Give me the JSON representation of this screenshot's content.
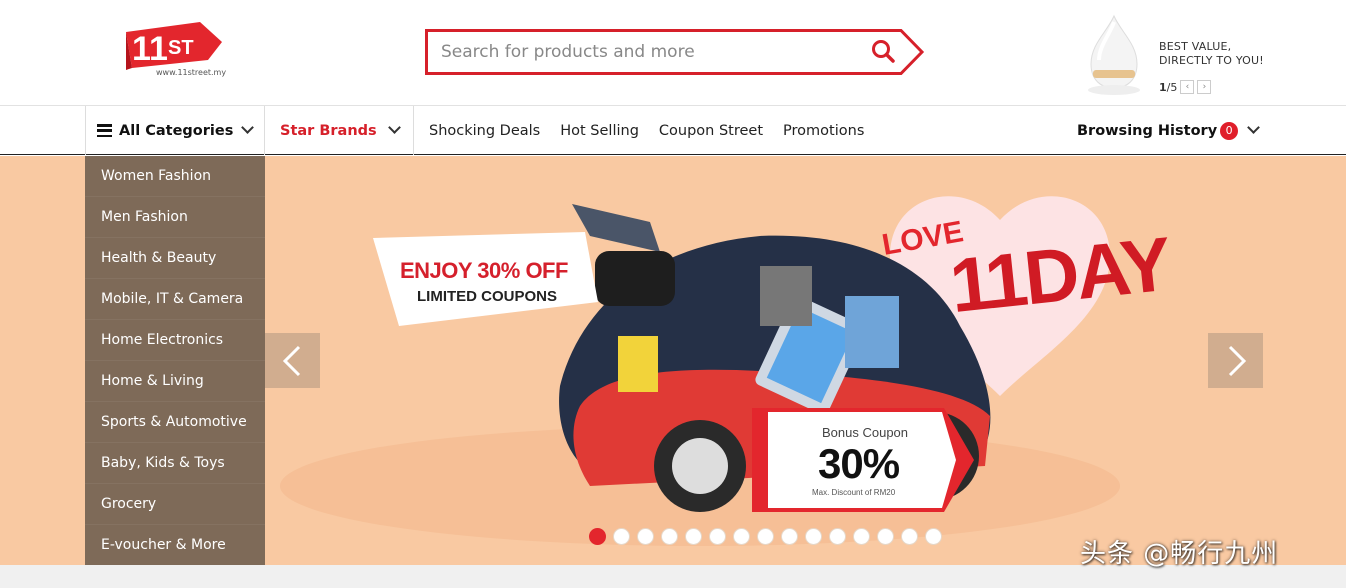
{
  "header": {
    "logo_text": "11ST",
    "logo_url_text": "www.11street.my",
    "search": {
      "placeholder": "Search for products and more"
    },
    "ad": {
      "line1": "BEST VALUE,",
      "line2": "DIRECTLY TO YOU!",
      "page_current": "1",
      "page_total": "/5",
      "prev": "‹",
      "next": "›"
    }
  },
  "nav": {
    "all_categories": "All Categories",
    "star_brands": "Star Brands",
    "links": [
      "Shocking Deals",
      "Hot Selling",
      "Coupon Street",
      "Promotions"
    ],
    "browsing_history": "Browsing History",
    "history_count": "0"
  },
  "categories": [
    "Women Fashion",
    "Men Fashion",
    "Health & Beauty",
    "Mobile, IT & Camera",
    "Home Electronics",
    "Home & Living",
    "Sports & Automotive",
    "Baby, Kids & Toys",
    "Grocery",
    "E-voucher & More"
  ],
  "banner": {
    "promo_line1": "ENJOY 30% OFF",
    "promo_line2": "LIMITED COUPONS",
    "love": "LOVE",
    "day_label": "11DAY",
    "coupon_title": "Bonus Coupon",
    "coupon_value": "30%",
    "coupon_note": "Max. Discount of RM20",
    "slide_count": 15,
    "active_slide": 1,
    "background_color": "#f9c9a2"
  },
  "watermark": "头条 @畅行九州",
  "colors": {
    "brand_red": "#d6202a",
    "menu_bg": "#7e6a58"
  }
}
